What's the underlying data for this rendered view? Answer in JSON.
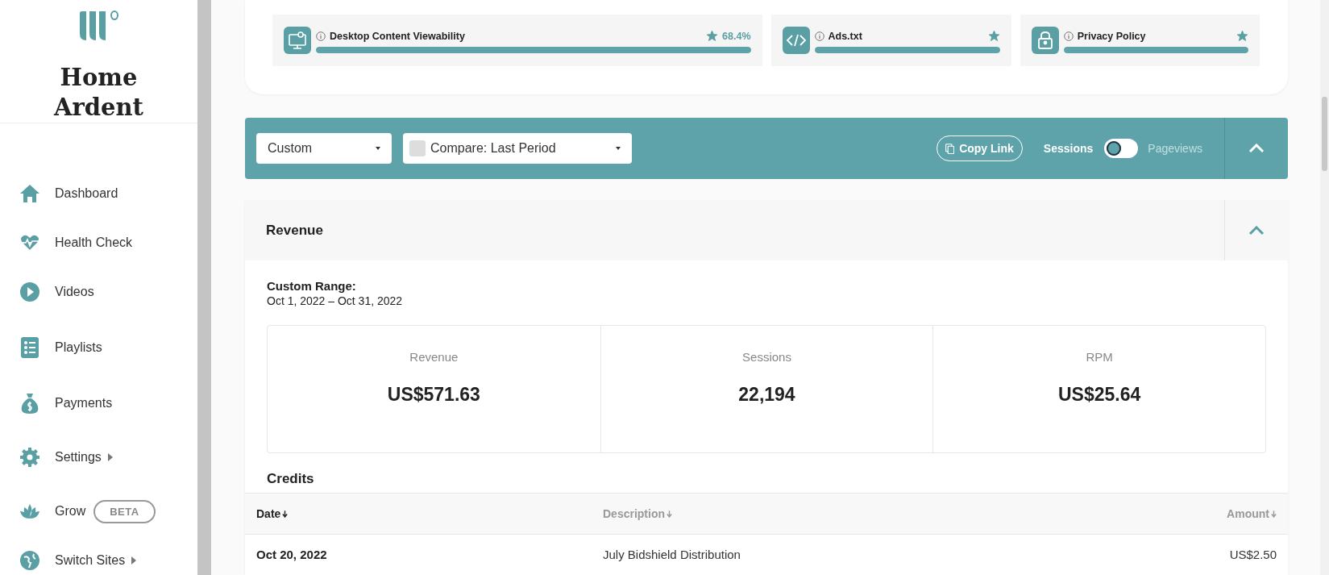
{
  "sidebar": {
    "brand": "Home Ardent",
    "items": [
      {
        "label": "Dashboard",
        "has_submenu": false
      },
      {
        "label": "Health Check",
        "has_submenu": false
      },
      {
        "label": "Videos",
        "has_submenu": false
      },
      {
        "label": "Playlists",
        "has_submenu": false
      },
      {
        "label": "Payments",
        "has_submenu": false
      },
      {
        "label": "Settings",
        "has_submenu": true
      },
      {
        "label": "Grow",
        "has_submenu": false,
        "badge": "BETA"
      },
      {
        "label": "Switch Sites",
        "has_submenu": true
      }
    ]
  },
  "health_metrics": [
    {
      "label": "Desktop Content Viewability",
      "level": 1,
      "starred": true,
      "reading": "68.4%"
    },
    {
      "label": "Ads.txt",
      "level": 1,
      "starred": true
    },
    {
      "label": "Privacy Policy",
      "level": 1,
      "starred": true
    }
  ],
  "toolbar": {
    "range_select": "Custom",
    "compare_checked": false,
    "compare_select": "Compare: Last Period",
    "copy_button": "Copy Link",
    "metric_toggle": [
      {
        "label": "Sessions",
        "selected": true
      },
      {
        "label": "Pageviews",
        "selected": false
      }
    ],
    "expanded": true
  },
  "revenue": {
    "title": "Revenue",
    "expanded": true,
    "range_label": "Custom Range:",
    "range": "Oct 1, 2022 – Oct 31, 2022",
    "stats": [
      {
        "label": "Revenue",
        "value": "US$571.63"
      },
      {
        "label": "Sessions",
        "value": "22,194"
      },
      {
        "label": "RPM",
        "value": "US$25.64"
      }
    ],
    "credits": {
      "title": "Credits",
      "columns": [
        {
          "label": "Date",
          "selected": true
        },
        {
          "label": "Description",
          "selected": false
        },
        {
          "label": "Amount",
          "selected": false
        }
      ],
      "rows": [
        [
          "Oct 20, 2022",
          "July Bidshield Distribution",
          "US$2.50"
        ]
      ]
    }
  }
}
